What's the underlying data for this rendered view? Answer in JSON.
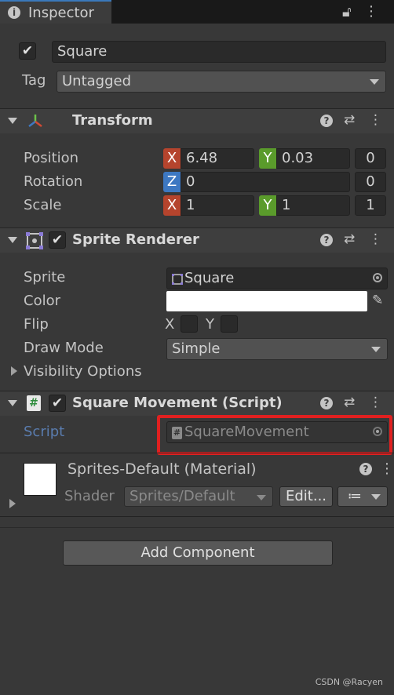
{
  "tab": {
    "title": "Inspector"
  },
  "gameobject": {
    "active": true,
    "name": "Square",
    "tag_label": "Tag",
    "tag_value": "Untagged"
  },
  "transform": {
    "title": "Transform",
    "position_label": "Position",
    "rotation_label": "Rotation",
    "scale_label": "Scale",
    "position": {
      "x_axis": "X",
      "x": "6.48",
      "y_axis": "Y",
      "y": "0.03",
      "z": "0"
    },
    "rotation": {
      "z_axis": "Z",
      "z_field": "0",
      "extra": "0"
    },
    "scale": {
      "x_axis": "X",
      "x": "1",
      "y_axis": "Y",
      "y": "1",
      "z": "1"
    }
  },
  "sprite_renderer": {
    "title": "Sprite Renderer",
    "enabled": true,
    "sprite_label": "Sprite",
    "sprite_value": "Square",
    "color_label": "Color",
    "color_value": "#ffffff",
    "flip_label": "Flip",
    "flip_x": "X",
    "flip_y": "Y",
    "draw_mode_label": "Draw Mode",
    "draw_mode_value": "Simple",
    "visibility_label": "Visibility Options"
  },
  "script_component": {
    "title": "Square Movement (Script)",
    "enabled": true,
    "script_label": "Script",
    "script_value": "SquareMovement"
  },
  "material": {
    "title": "Sprites-Default (Material)",
    "shader_label": "Shader",
    "shader_value": "Sprites/Default",
    "edit_label": "Edit...",
    "list_icon": "≔"
  },
  "add_component": {
    "label": "Add Component"
  },
  "watermark": "CSDN @Racyen"
}
